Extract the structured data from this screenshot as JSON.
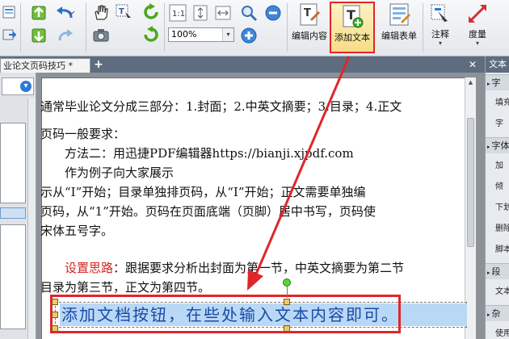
{
  "toolbar": {
    "zoom_value": "100%",
    "big_buttons": {
      "edit_content": "编辑内容",
      "add_text": "添加文本",
      "edit_form": "编辑表单",
      "annotate": "注释",
      "measure": "度量"
    },
    "chevron": "▾"
  },
  "tabs": {
    "active_label": "业论文页码技巧 *",
    "add_label": "+",
    "close_label": "✕"
  },
  "document": {
    "lines": [
      "通常毕业论文分成三部分：1.封面；2.中英文摘要；3.目录；4.正文",
      "页码一般要求：",
      "方法二：用迅捷PDF编辑器https://bianji.xjpdf.com",
      "作为例子向大家展示",
      "示从“I”开始；目录单独排页码，从“I”开始；正文需要单独编",
      "页码，从“1”开始。页码在页面底端（页脚）居中书写，页码使",
      "宋体五号字。"
    ],
    "idea_keyword": "设置思路",
    "idea_rest": "：跟据要求分析出封面为第一节，中英文摘要为第二节",
    "idea_line2": "目录为第三节，正文为第四节。",
    "inserted_text": "添加文档按钮，在些处输入文本内容即可。"
  },
  "right_panel": {
    "header": "文本",
    "items": [
      {
        "type": "section",
        "label": "字"
      },
      {
        "type": "item",
        "label": "填充"
      },
      {
        "type": "item",
        "label": "字"
      },
      {
        "type": "section",
        "label": "字体"
      },
      {
        "type": "item",
        "label": "加"
      },
      {
        "type": "item",
        "label": "倾"
      },
      {
        "type": "item",
        "label": "下划"
      },
      {
        "type": "item",
        "label": "删除"
      },
      {
        "type": "item",
        "label": "脚本"
      },
      {
        "type": "section",
        "label": "段"
      },
      {
        "type": "item",
        "label": "文本"
      },
      {
        "type": "section",
        "label": "杂"
      },
      {
        "type": "item",
        "label": "使用"
      }
    ]
  },
  "colors": {
    "highlight_red": "#e0262b",
    "keyword_red": "#d4241d",
    "inserted_text_blue": "#1a4aa7",
    "selection_blue": "#b9d8f5"
  }
}
